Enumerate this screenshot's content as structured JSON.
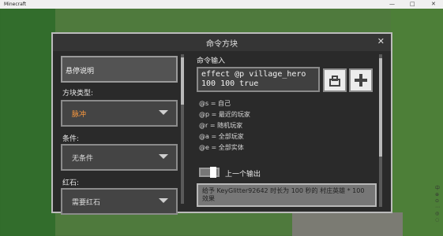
{
  "window_title": "Minecraft",
  "window_controls": [
    "—",
    "□",
    "✕"
  ],
  "modal": {
    "title": "命令方块",
    "close": "✕",
    "left": {
      "hover_note": "悬停说明",
      "block_type_label": "方块类型:",
      "block_type_value": "脉冲",
      "condition_label": "条件:",
      "condition_value": "无条件",
      "redstone_label": "红石:",
      "redstone_value": "需要红石"
    },
    "right": {
      "command_input_label": "命令输入",
      "command_value": "effect @p village_hero\n100 100 true",
      "selectors": [
        "@s = 自己",
        "@p = 最近的玩家",
        "@r = 随机玩家",
        "@a = 全部玩家",
        "@e = 全部实体"
      ],
      "previous_output_label": "上一个输出",
      "output_text": "给予 KeyGlitter92642 时长为 100 秒的 村庄英雄 * 100 效果"
    }
  },
  "colors": {
    "dropdown_accent": "#ff9a3d"
  }
}
